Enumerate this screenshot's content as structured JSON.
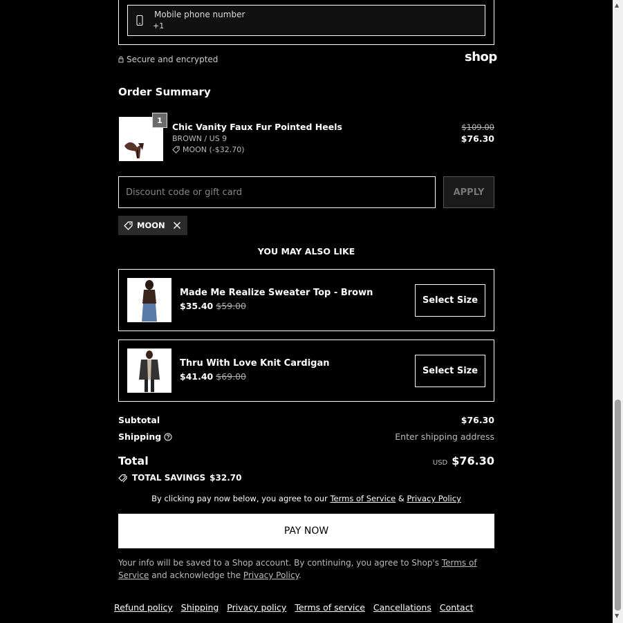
{
  "contact": {
    "phone_label": "Mobile phone number",
    "phone_prefix": "+1",
    "secure_text": "Secure and encrypted",
    "shop_logo": "shop"
  },
  "summary": {
    "title": "Order Summary",
    "item": {
      "quantity": "1",
      "name": "Chic Vanity Faux Fur Pointed Heels",
      "variant": "BROWN / US 9",
      "discount": "MOON (-$32.70)",
      "original_price": "$109.00",
      "price": "$76.30"
    },
    "discount_placeholder": "Discount code or gift card",
    "apply_label": "APPLY",
    "applied_code": "MOON"
  },
  "recommendations": {
    "heading": "YOU MAY ALSO LIKE",
    "items": [
      {
        "name": "Made Me Realize Sweater Top - Brown",
        "price": "$35.40",
        "old_price": "$59.00",
        "button": "Select Size"
      },
      {
        "name": "Thru With Love Knit Cardigan",
        "price": "$41.40",
        "old_price": "$69.00",
        "button": "Select Size"
      }
    ]
  },
  "totals": {
    "subtotal_label": "Subtotal",
    "subtotal_value": "$76.30",
    "shipping_label": "Shipping",
    "shipping_value": "Enter shipping address",
    "total_label": "Total",
    "currency": "USD",
    "total_value": "$76.30",
    "savings_label": "TOTAL SAVINGS",
    "savings_value": "$32.70"
  },
  "legal": {
    "agree_prefix": "By clicking pay now below, you agree to our",
    "terms_link": "Terms of Service",
    "amp": "&",
    "privacy_link": "Privacy Policy",
    "pay_label": "PAY NOW",
    "info_prefix": "Your info will be saved to a Shop account. By continuing, you agree to Shop's",
    "info_terms": "Terms of Service",
    "info_mid": "and acknowledge the",
    "info_privacy": "Privacy Policy",
    "info_end": "."
  },
  "footer": {
    "links": [
      "Refund policy",
      "Shipping",
      "Privacy policy",
      "Terms of service",
      "Cancellations",
      "Contact"
    ]
  }
}
